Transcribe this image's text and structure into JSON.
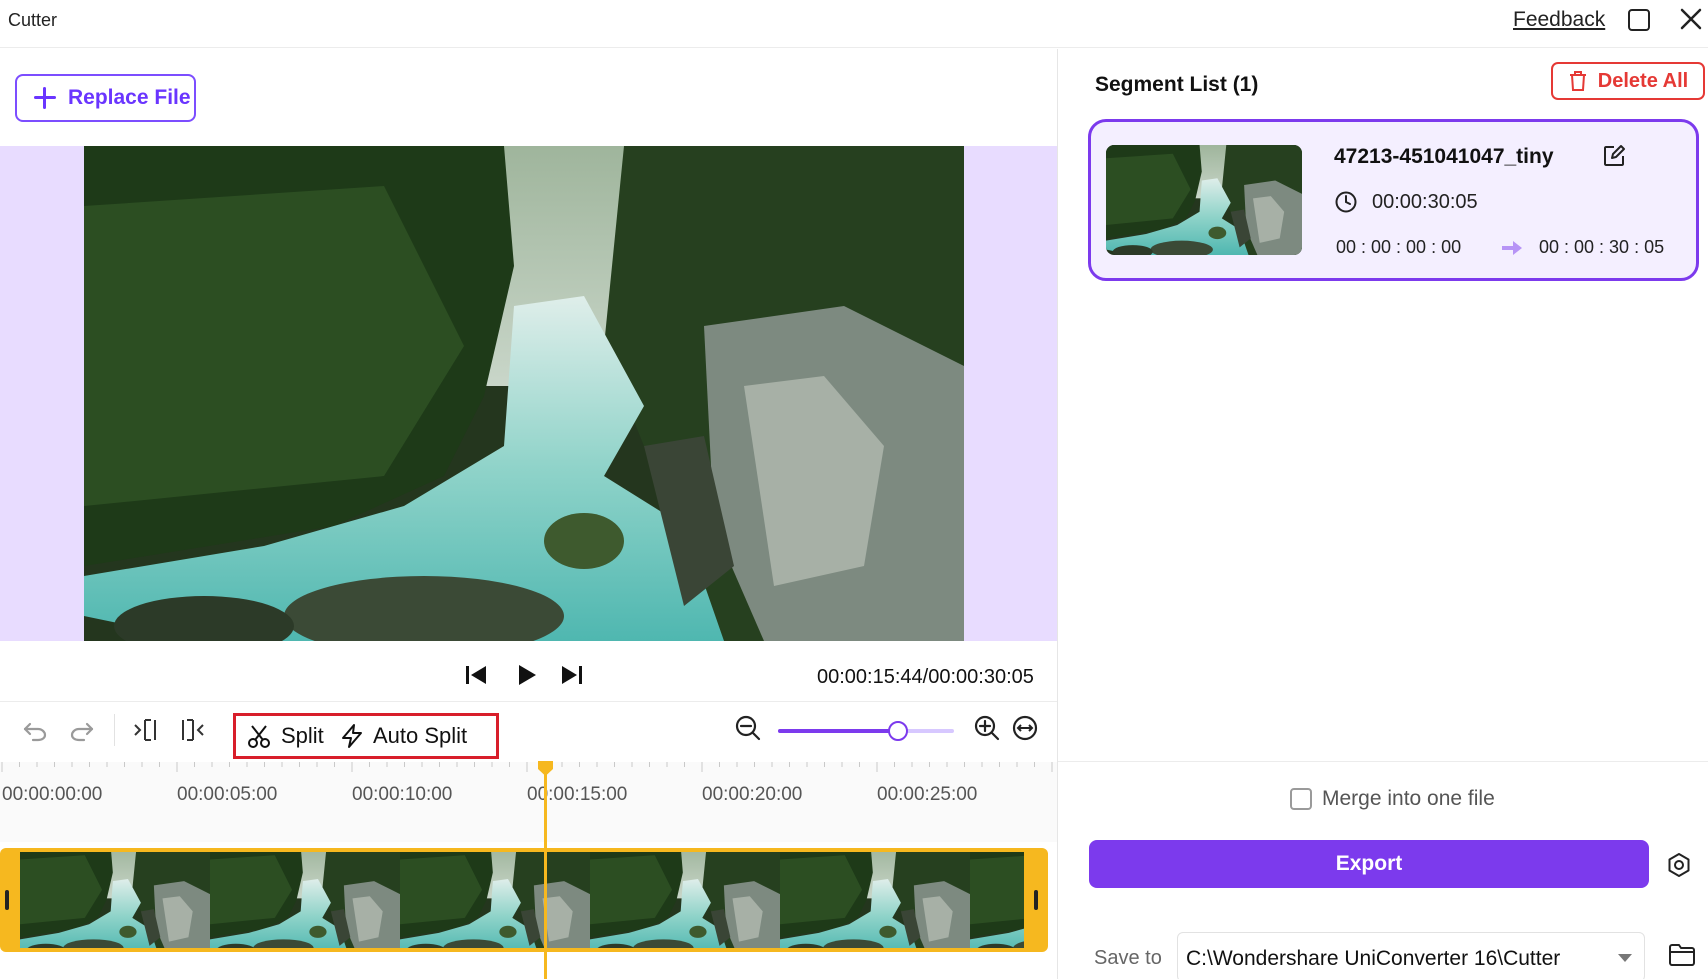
{
  "window": {
    "title": "Cutter",
    "feedback_label": "Feedback"
  },
  "editor": {
    "replace_file_label": "Replace File",
    "timecode": "00:00:15:44/00:00:30:05",
    "split_label": "Split",
    "auto_split_label": "Auto Split",
    "zoom_level": 0.68,
    "playhead_position_seconds": 15.5
  },
  "timeline": {
    "ruler_labels": [
      "00:00:00:00",
      "00:00:05:00",
      "00:00:10:00",
      "00:00:15:00",
      "00:00:20:00",
      "00:00:25:00"
    ]
  },
  "segment_list": {
    "title": "Segment List (1)",
    "delete_all_label": "Delete All",
    "segments": [
      {
        "name": "47213-451041047_tiny",
        "duration": "00:00:30:05",
        "start": "00 : 00 : 00 : 00",
        "end": "00 : 00 : 30 : 05"
      }
    ]
  },
  "output": {
    "merge_label": "Merge into one file",
    "merge_checked": false,
    "export_label": "Export",
    "save_to_label": "Save to",
    "save_path": "C:\\Wondershare UniConverter 16\\Cutter"
  },
  "colors": {
    "accent": "#7c3aed",
    "preview_bg": "#e8dcff",
    "delete": "#e53935",
    "timeline_track": "#f6b81f",
    "highlight_box": "#d81e2a"
  }
}
